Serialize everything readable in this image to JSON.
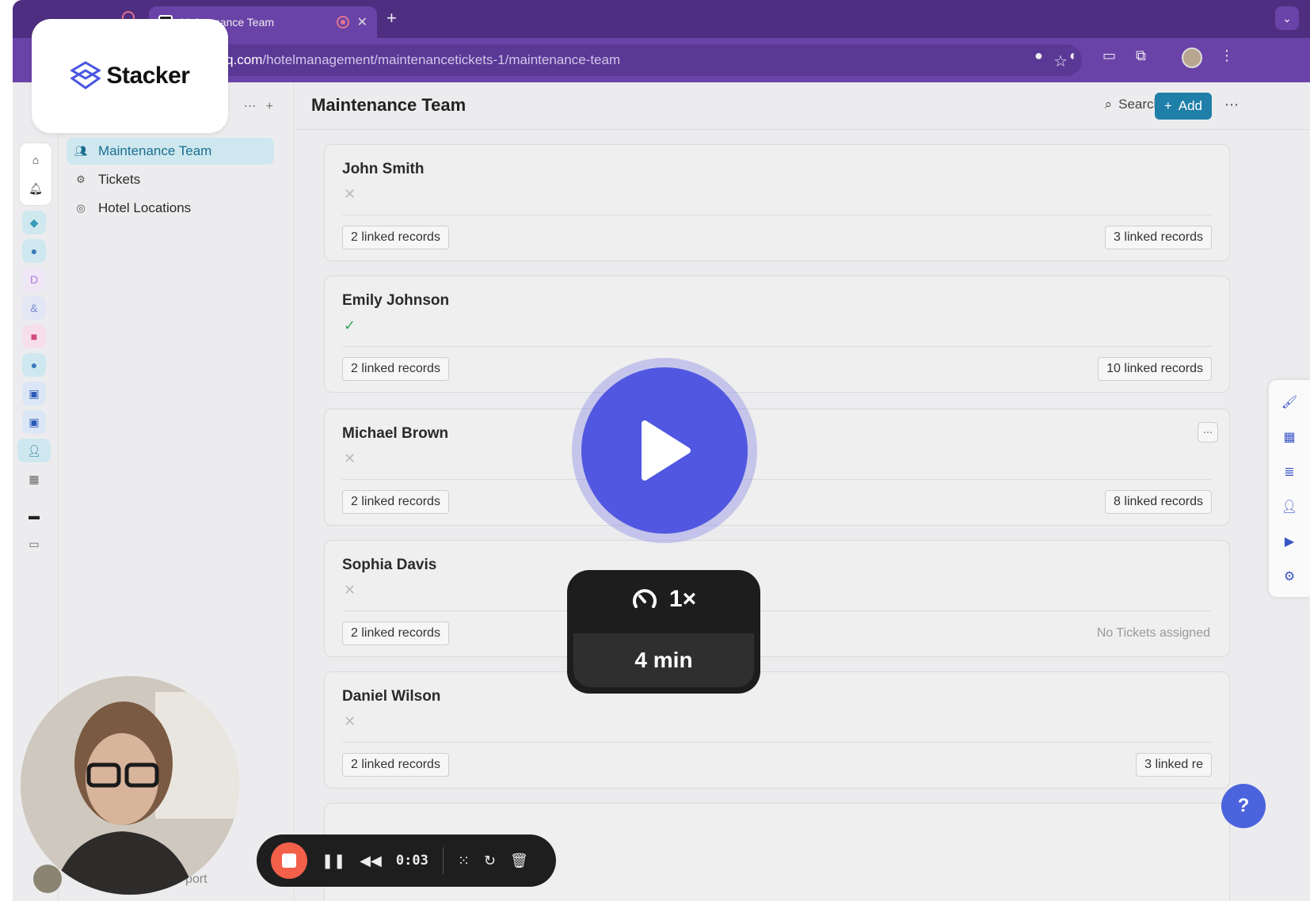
{
  "browser": {
    "tab_title": "Maintenance Team",
    "url_host": "rhq.com",
    "url_path": "/hotelmanagement/maintenancetickets-1/maintenance-team"
  },
  "brand": {
    "logo_text": "Stacker"
  },
  "sidebar": {
    "items": [
      {
        "label": "Maintenance Team",
        "icon": "people-icon",
        "active": true
      },
      {
        "label": "Tickets",
        "icon": "gear-icon",
        "active": false
      },
      {
        "label": "Hotel Locations",
        "icon": "location-pin-icon",
        "active": false
      }
    ]
  },
  "header": {
    "title": "Maintenance Team",
    "search_label": "Search",
    "add_label": "Add"
  },
  "records": [
    {
      "name": "John Smith",
      "status": "x",
      "left_pill": "2 linked records",
      "right_pill": "3 linked records"
    },
    {
      "name": "Emily Johnson",
      "status": "check",
      "left_pill": "2 linked records",
      "right_pill": "10 linked records"
    },
    {
      "name": "Michael Brown",
      "status": "x",
      "left_pill": "2 linked records",
      "right_pill": "8 linked records"
    },
    {
      "name": "Sophia Davis",
      "status": "x",
      "left_pill": "2 linked records",
      "right_text": "No Tickets assigned"
    },
    {
      "name": "Daniel Wilson",
      "status": "x",
      "left_pill": "2 linked records",
      "right_pill": "3 linked re"
    }
  ],
  "player": {
    "speed": "1×",
    "duration": "4 min"
  },
  "recorder": {
    "elapsed": "0:03"
  },
  "footer": {
    "support_label": "port"
  },
  "colors": {
    "accent": "#1f7fa8",
    "play": "#5157e0",
    "record": "#f2604a",
    "browser_chrome": "#6a43a8"
  }
}
